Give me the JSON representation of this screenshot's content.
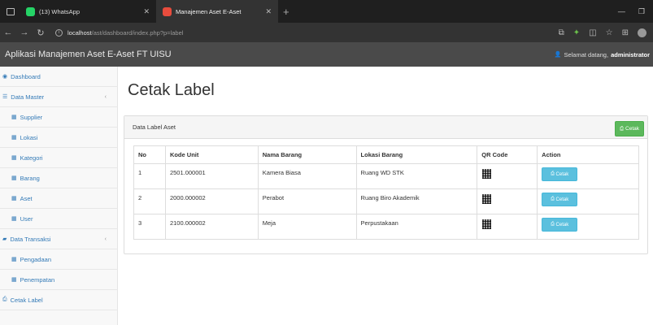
{
  "browser": {
    "tabs": [
      {
        "title": "(13) WhatsApp",
        "active": false
      },
      {
        "title": "Manajemen Aset E-Aset",
        "active": true
      }
    ],
    "url_host": "localhost",
    "url_path": "/ast/dashboard/index.php?p=label"
  },
  "app": {
    "title": "Aplikasi Manajemen Aset E-Aset FT UISU",
    "welcome_prefix": "Selamat datang,",
    "username": "administrator"
  },
  "sidebar": {
    "items": [
      {
        "label": "Dashboard",
        "icon": "dashboard-icon",
        "level": 1
      },
      {
        "label": "Data Master",
        "icon": "list-icon",
        "level": 1,
        "expandable": true
      },
      {
        "label": "Supplier",
        "icon": "table-icon",
        "level": 2
      },
      {
        "label": "Lokasi",
        "icon": "table-icon",
        "level": 2
      },
      {
        "label": "Kategori",
        "icon": "table-icon",
        "level": 2
      },
      {
        "label": "Barang",
        "icon": "table-icon",
        "level": 2
      },
      {
        "label": "Aset",
        "icon": "table-icon",
        "level": 2
      },
      {
        "label": "User",
        "icon": "table-icon",
        "level": 2
      },
      {
        "label": "Data Transaksi",
        "icon": "briefcase-icon",
        "level": 1,
        "expandable": true
      },
      {
        "label": "Pengadaan",
        "icon": "table-icon",
        "level": 2
      },
      {
        "label": "Penempatan",
        "icon": "table-icon",
        "level": 2
      },
      {
        "label": "Cetak Label",
        "icon": "print-icon",
        "level": 1
      }
    ]
  },
  "main": {
    "page_title": "Cetak Label",
    "panel_title": "Data Label Aset",
    "print_all_label": "Cetak",
    "table": {
      "headers": [
        "No",
        "Kode Unit",
        "Nama Barang",
        "Lokasi Barang",
        "QR Code",
        "Action"
      ],
      "rows": [
        {
          "no": "1",
          "kode": "2501.000001",
          "nama": "Kamera Biasa",
          "lokasi": "Ruang WD STK",
          "action": "Cetak"
        },
        {
          "no": "2",
          "kode": "2000.000002",
          "nama": "Perabot",
          "lokasi": "Ruang Biro Akademik",
          "action": "Cetak"
        },
        {
          "no": "3",
          "kode": "2100.000002",
          "nama": "Meja",
          "lokasi": "Perpustakaan",
          "action": "Cetak"
        }
      ]
    }
  },
  "colors": {
    "link": "#337ab7",
    "success": "#5cb85c",
    "info": "#5bc0de",
    "appbar": "#4a4a4a"
  }
}
